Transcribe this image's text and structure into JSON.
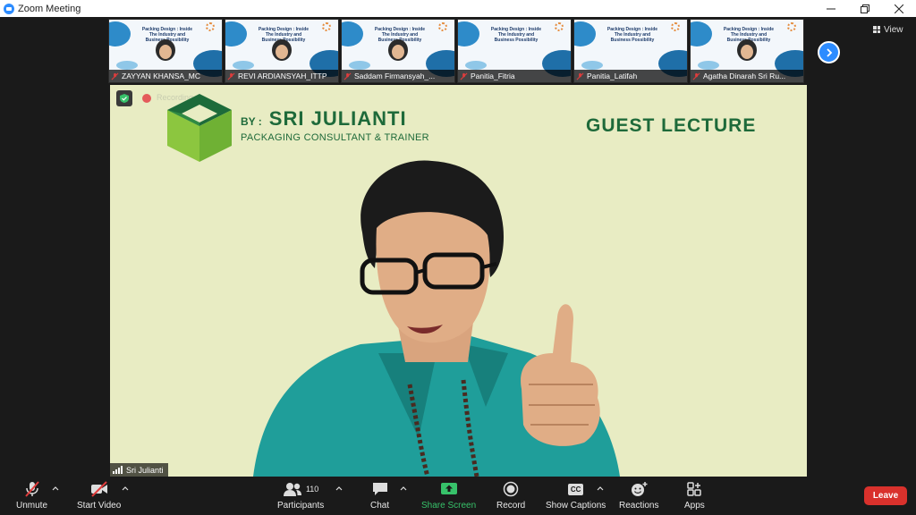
{
  "window": {
    "title": "Zoom Meeting"
  },
  "thumbnails": {
    "slide_text": "Packing Design : Inside The Industry and Business Possibility",
    "participants": [
      {
        "name": "ZAYYAN KHANSA_MC",
        "has_person": true
      },
      {
        "name": "REVI ARDIANSYAH_ITTP",
        "has_person": true
      },
      {
        "name": "Saddam Firmansyah_...",
        "has_person": true
      },
      {
        "name": "Panitia_Fitria",
        "has_person": false
      },
      {
        "name": "Panitia_Latifah",
        "has_person": false
      },
      {
        "name": "Agatha Dinarah Sri Ru...",
        "has_person": true
      }
    ]
  },
  "view_button": {
    "label": "View"
  },
  "main": {
    "recording_label": "Recording",
    "by_label": "BY :",
    "presenter_name": "SRI JULIANTI",
    "presenter_title": "PACKAGING CONSULTANT & TRAINER",
    "lecture_title": "GUEST LECTURE",
    "speaker_name": "Sri Julianti"
  },
  "toolbar": {
    "unmute": "Unmute",
    "start_video": "Start Video",
    "participants": "Participants",
    "participant_count": "110",
    "chat": "Chat",
    "share_screen": "Share Screen",
    "record": "Record",
    "show_captions": "Show Captions",
    "cc": "CC",
    "reactions": "Reactions",
    "apps": "Apps",
    "leave": "Leave"
  },
  "colors": {
    "zoom_blue": "#2d8cff",
    "share_green": "#37c26a",
    "leave_red": "#d9312c",
    "slide_bg": "#e8ecc3",
    "brand_green": "#1e6a3a"
  }
}
